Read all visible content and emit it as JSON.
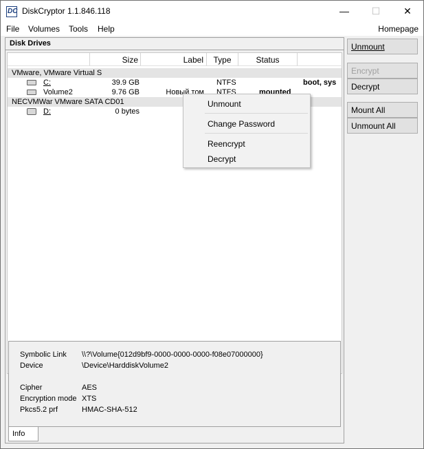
{
  "window": {
    "title": "DiskCryptor 1.1.846.118",
    "icon_letter": "DC",
    "min_glyph": "—",
    "max_glyph": "☐",
    "close_glyph": "✕"
  },
  "menubar": {
    "items": [
      "File",
      "Volumes",
      "Tools",
      "Help"
    ],
    "homepage": "Homepage"
  },
  "panel": {
    "title": "Disk Drives"
  },
  "columns": [
    "",
    "Size",
    "Label",
    "Type",
    "Status",
    ""
  ],
  "devices": [
    {
      "name": "VMware, VMware Virtual S",
      "volumes": [
        {
          "name": "C:",
          "size": "39.9 GB",
          "label": "",
          "type": "NTFS",
          "status": "",
          "flags": "boot, sys"
        },
        {
          "name": "Volume2",
          "size": "9.76 GB",
          "label": "Новый том",
          "type": "NTFS",
          "status": "mounted",
          "flags": ""
        }
      ]
    },
    {
      "name": "NECVMWar VMware SATA CD01",
      "volumes": [
        {
          "name": "D:",
          "size": "0 bytes",
          "label": "",
          "type": "",
          "status": "",
          "flags": ""
        }
      ]
    }
  ],
  "info": {
    "tab": "Info",
    "rows": [
      {
        "label": "Symbolic Link",
        "value": "\\\\?\\Volume{012d9bf9-0000-0000-0000-f08e07000000}"
      },
      {
        "label": "Device",
        "value": "\\Device\\HarddiskVolume2"
      },
      {
        "label": "Cipher",
        "value": "AES"
      },
      {
        "label": "Encryption mode",
        "value": "XTS"
      },
      {
        "label": "Pkcs5.2 prf",
        "value": "HMAC-SHA-512"
      }
    ]
  },
  "buttons": {
    "unmount": "Unmount",
    "encrypt": "Encrypt",
    "decrypt": "Decrypt",
    "mount_all": "Mount All",
    "unmount_all": "Unmount All"
  },
  "context_menu": {
    "items": [
      "Unmount",
      "Change Password",
      "Reencrypt",
      "Decrypt"
    ]
  }
}
